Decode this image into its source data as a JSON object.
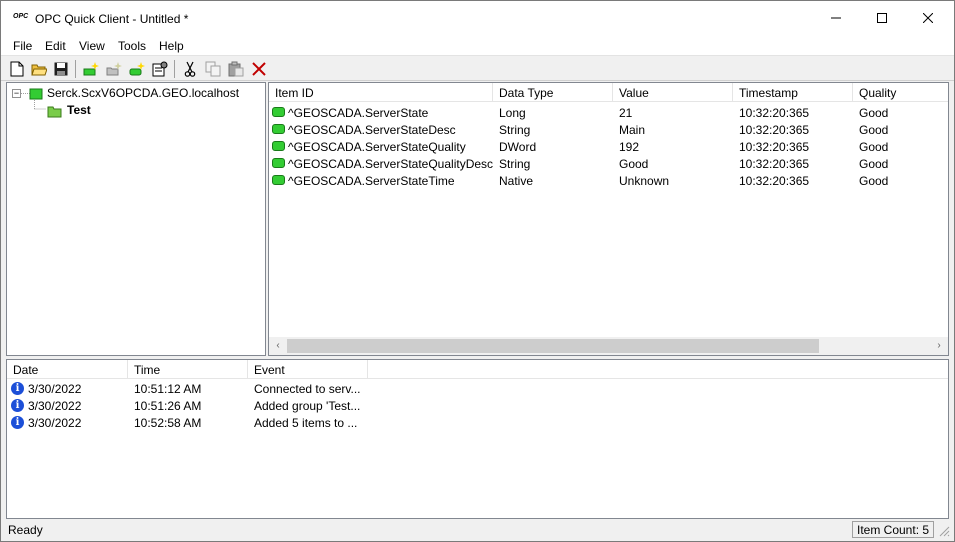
{
  "window": {
    "title": "OPC Quick Client - Untitled *",
    "icon_label": "OPC",
    "minimize_glyph": "—",
    "maximize_glyph": "☐",
    "close_glyph": "✕"
  },
  "menu": {
    "file": "File",
    "edit": "Edit",
    "view": "View",
    "tools": "Tools",
    "help": "Help"
  },
  "toolbar": {
    "icons": [
      "new-file-icon",
      "open-folder-icon",
      "save-icon",
      "new-server-icon",
      "new-group-icon",
      "new-item-icon",
      "properties-icon",
      "cut-icon",
      "copy-icon",
      "paste-icon",
      "delete-icon"
    ]
  },
  "tree": {
    "server": "Serck.ScxV6OPCDA.GEO.localhost",
    "group": "Test",
    "collapse_glyph": "−"
  },
  "items": {
    "columns": [
      "Item ID",
      "Data Type",
      "Value",
      "Timestamp",
      "Quality"
    ],
    "rows": [
      {
        "item_id": "^GEOSCADA.ServerState",
        "data_type": "Long",
        "value": "21",
        "timestamp": "10:32:20:365",
        "quality": "Good"
      },
      {
        "item_id": "^GEOSCADA.ServerStateDesc",
        "data_type": "String",
        "value": "Main",
        "timestamp": "10:32:20:365",
        "quality": "Good"
      },
      {
        "item_id": "^GEOSCADA.ServerStateQuality",
        "data_type": "DWord",
        "value": "192",
        "timestamp": "10:32:20:365",
        "quality": "Good"
      },
      {
        "item_id": "^GEOSCADA.ServerStateQualityDesc",
        "data_type": "String",
        "value": "Good",
        "timestamp": "10:32:20:365",
        "quality": "Good"
      },
      {
        "item_id": "^GEOSCADA.ServerStateTime",
        "data_type": "Native",
        "value": "Unknown",
        "timestamp": "10:32:20:365",
        "quality": "Good"
      }
    ],
    "scroll_left": "‹",
    "scroll_right": "›"
  },
  "log": {
    "columns": [
      "Date",
      "Time",
      "Event"
    ],
    "rows": [
      {
        "date": "3/30/2022",
        "time": "10:51:12 AM",
        "event": "Connected to serv..."
      },
      {
        "date": "3/30/2022",
        "time": "10:51:26 AM",
        "event": "Added group 'Test..."
      },
      {
        "date": "3/30/2022",
        "time": "10:52:58 AM",
        "event": "Added 5 items to ..."
      }
    ],
    "info_glyph": "i"
  },
  "status": {
    "text": "Ready",
    "item_count": "Item Count: 5"
  },
  "colors": {
    "tag_green": "#33cc33",
    "info_blue": "#1c4fd8",
    "delete_red": "#c00000"
  }
}
